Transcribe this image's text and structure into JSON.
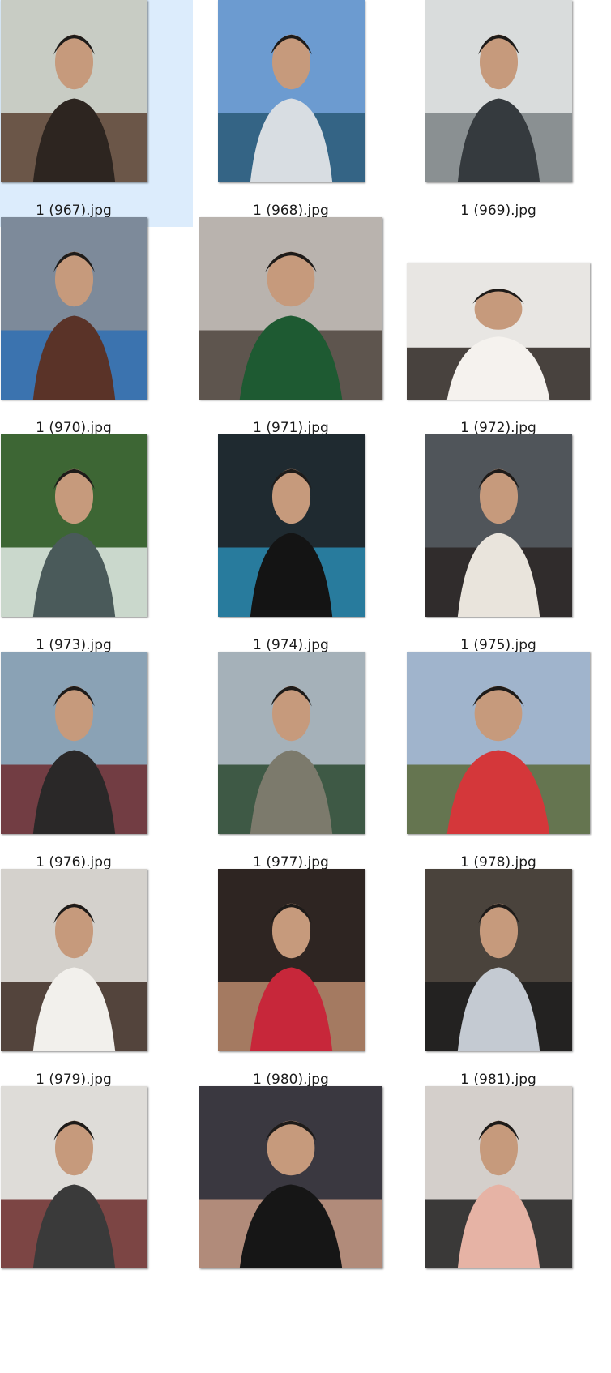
{
  "selected_index": 0,
  "files": [
    {
      "name": "1 (967).jpg",
      "thumb": "portrait-thumbnail-icon",
      "orient": "portrait",
      "colors": [
        "#c8ccc4",
        "#5a4132",
        "#2d2520"
      ]
    },
    {
      "name": "1 (968).jpg",
      "thumb": "yacht-sea-thumbnail-icon",
      "orient": "portrait",
      "colors": [
        "#6c9bd0",
        "#2a5a78",
        "#d8dde2"
      ]
    },
    {
      "name": "1 (969).jpg",
      "thumb": "gym-thumbnail-icon",
      "orient": "portrait",
      "colors": [
        "#d9dcdc",
        "#7b8285",
        "#353a3e"
      ]
    },
    {
      "name": "1 (970).jpg",
      "thumb": "stadium-group-thumbnail-icon",
      "orient": "portrait",
      "colors": [
        "#7d8a9a",
        "#2f6fb3",
        "#5a3328"
      ]
    },
    {
      "name": "1 (971).jpg",
      "thumb": "group-party-thumbnail-icon",
      "orient": "landscape",
      "colors": [
        "#b9b3ae",
        "#4e443d",
        "#1e5a32"
      ]
    },
    {
      "name": "1 (972).jpg",
      "thumb": "three-people-thumbnail-icon",
      "orient": "landscape",
      "colors": [
        "#e8e6e3",
        "#2c2521",
        "#f5f2ee"
      ]
    },
    {
      "name": "1 (973).jpg",
      "thumb": "waterfall-thumbnail-icon",
      "orient": "portrait",
      "colors": [
        "#3d6634",
        "#e3ece8",
        "#4a5a5a"
      ]
    },
    {
      "name": "1 (974).jpg",
      "thumb": "event-suit-thumbnail-icon",
      "orient": "portrait",
      "colors": [
        "#1f2a30",
        "#2a8ab0",
        "#141414"
      ]
    },
    {
      "name": "1 (975).jpg",
      "thumb": "two-people-thumbnail-icon",
      "orient": "portrait",
      "colors": [
        "#50555a",
        "#2a2625",
        "#e9e4dc"
      ]
    },
    {
      "name": "1 (976).jpg",
      "thumb": "mountain-portrait-thumbnail-icon",
      "orient": "portrait",
      "colors": [
        "#8aa2b5",
        "#6d2c2f",
        "#2a2828"
      ]
    },
    {
      "name": "1 (977).jpg",
      "thumb": "forest-rock-thumbnail-icon",
      "orient": "portrait",
      "colors": [
        "#a5b1b9",
        "#2c4a30",
        "#7c7a6c"
      ]
    },
    {
      "name": "1 (978).jpg",
      "thumb": "family-cabin-thumbnail-icon",
      "orient": "landscape",
      "colors": [
        "#a0b4cc",
        "#5b6a3a",
        "#d4373a"
      ]
    },
    {
      "name": "1 (979).jpg",
      "thumb": "vest-portrait-thumbnail-icon",
      "orient": "portrait",
      "colors": [
        "#d4d1cc",
        "#3c2c22",
        "#f2f0ec"
      ]
    },
    {
      "name": "1 (980).jpg",
      "thumb": "mirror-selfie-thumbnail-icon",
      "orient": "portrait",
      "colors": [
        "#2e2522",
        "#b98a6c",
        "#c7273a"
      ]
    },
    {
      "name": "1 (981).jpg",
      "thumb": "laptop-selfie-thumbnail-icon",
      "orient": "portrait",
      "colors": [
        "#4a433c",
        "#1c1c1c",
        "#c4cad2"
      ]
    },
    {
      "name": "",
      "thumb": "costume-thumbnail-icon",
      "orient": "portrait",
      "colors": [
        "#dedcd8",
        "#6b2a2a",
        "#3a3a3a"
      ]
    },
    {
      "name": "",
      "thumb": "selfie-shop-thumbnail-icon",
      "orient": "landscape",
      "colors": [
        "#3a3840",
        "#c79a85",
        "#161616"
      ]
    },
    {
      "name": "",
      "thumb": "product-table-thumbnail-icon",
      "orient": "portrait",
      "colors": [
        "#d4cfcb",
        "#1f1f1f",
        "#e6b3a5"
      ]
    }
  ]
}
